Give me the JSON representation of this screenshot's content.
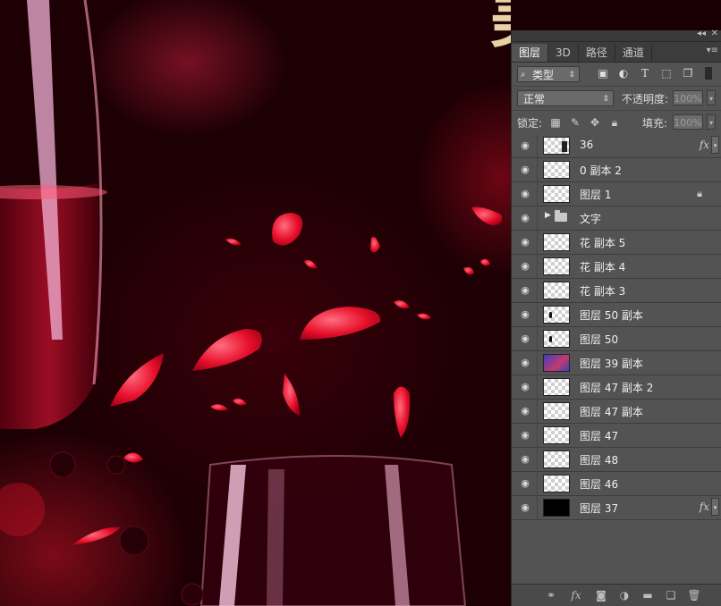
{
  "canvas": {
    "headline": "美丽"
  },
  "panel": {
    "tabs": [
      "图层",
      "3D",
      "路径",
      "通道"
    ],
    "active_tab": 0,
    "collapse_glyph": "◂◂",
    "close_glyph": "✕",
    "menu_glyph": "▾≡",
    "filter": {
      "icon": "search-icon",
      "label": "类型",
      "icons": [
        "image-filter-icon",
        "adjustment-filter-icon",
        "text-filter-icon",
        "shape-filter-icon",
        "smart-object-filter-icon"
      ]
    },
    "blend_mode": "正常",
    "opacity_label": "不透明度:",
    "opacity_value": "100%",
    "lock_label": "锁定:",
    "lock_icons": [
      "lock-transparent-icon",
      "lock-brush-icon",
      "lock-move-icon",
      "lock-all-icon"
    ],
    "fill_label": "填充:",
    "fill_value": "100%",
    "layers": [
      {
        "name": "36",
        "thumb": "mark2",
        "fx": "fx"
      },
      {
        "name": "0 副本 2",
        "thumb": "checker"
      },
      {
        "name": "图层 1",
        "thumb": "checker",
        "locked": true
      },
      {
        "name": "文字",
        "thumb": "folder"
      },
      {
        "name": "花 副本 5",
        "thumb": "checker"
      },
      {
        "name": "花 副本 4",
        "thumb": "checker"
      },
      {
        "name": "花 副本 3",
        "thumb": "checker"
      },
      {
        "name": "图层 50 副本",
        "thumb": "mark"
      },
      {
        "name": "图层 50",
        "thumb": "mark"
      },
      {
        "name": "图层 39 副本",
        "thumb": "photo"
      },
      {
        "name": "图层 47 副本 2",
        "thumb": "checker"
      },
      {
        "name": "图层 47 副本",
        "thumb": "checker"
      },
      {
        "name": "图层 47",
        "thumb": "checker"
      },
      {
        "name": "图层 48",
        "thumb": "checker"
      },
      {
        "name": "图层 46",
        "thumb": "checker"
      },
      {
        "name": "图层 37",
        "thumb": "black",
        "fx": "fx"
      }
    ],
    "fx_label": "fx",
    "bottom_icons": [
      "link-layers-icon",
      "add-style-icon",
      "add-mask-icon",
      "adjustment-layer-icon",
      "new-group-icon",
      "new-layer-icon",
      "delete-layer-icon"
    ]
  }
}
